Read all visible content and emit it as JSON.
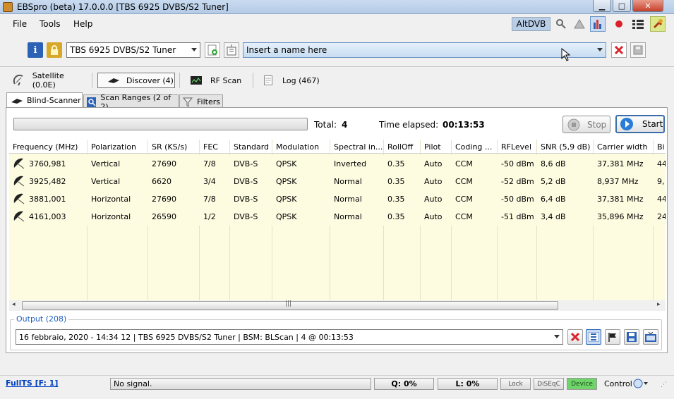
{
  "window": {
    "title": "EBSpro (beta) 17.0.0.0 [TBS 6925 DVBS/S2 Tuner]"
  },
  "menu": [
    "File",
    "Tools",
    "Help"
  ],
  "toolbar": {
    "altdvb_label": "AltDVB",
    "tuner_select": "TBS 6925 DVBS/S2 Tuner",
    "name_placeholder": "Insert a name here"
  },
  "main_tabs": [
    {
      "label": "Satellite (0.0E)",
      "icon": "satellite-dish-icon"
    },
    {
      "label": "Discover (4)",
      "icon": "discover-icon"
    },
    {
      "label": "RF Scan",
      "icon": "rf-scan-icon"
    },
    {
      "label": "Log (467)",
      "icon": "log-icon"
    }
  ],
  "sub_tabs": [
    {
      "label": "Blind-Scanner",
      "icon": "satellite-icon"
    },
    {
      "label": "Scan Ranges (2 of 2)",
      "icon": "scan-ranges-icon"
    },
    {
      "label": "Filters",
      "icon": "filter-icon"
    }
  ],
  "scan": {
    "total_label": "Total:",
    "total_value": "4",
    "elapsed_label": "Time elapsed:",
    "elapsed_value": "00:13:53",
    "stop_label": "Stop",
    "start_label": "Start"
  },
  "table": {
    "columns": [
      "Frequency (MHz)",
      "Polarization",
      "SR (KS/s)",
      "FEC",
      "Standard",
      "Modulation",
      "Spectral in...",
      "RollOff",
      "Pilot",
      "Coding ...",
      "RFLevel",
      "SNR (5,9 dB)",
      "Carrier width",
      "Bi"
    ],
    "rows": [
      [
        "3760,981",
        "Vertical",
        "27690",
        "7/8",
        "DVB-S",
        "QPSK",
        "Inverted",
        "0.35",
        "Auto",
        "CCM",
        "-50 dBm",
        "8,6 dB",
        "37,381 MHz",
        "44"
      ],
      [
        "3925,482",
        "Vertical",
        "6620",
        "3/4",
        "DVB-S",
        "QPSK",
        "Normal",
        "0.35",
        "Auto",
        "CCM",
        "-52 dBm",
        "5,2 dB",
        "8,937 MHz",
        "9,"
      ],
      [
        "3881,001",
        "Horizontal",
        "27690",
        "7/8",
        "DVB-S",
        "QPSK",
        "Normal",
        "0.35",
        "Auto",
        "CCM",
        "-50 dBm",
        "6,4 dB",
        "37,381 MHz",
        "44"
      ],
      [
        "4161,003",
        "Horizontal",
        "26590",
        "1/2",
        "DVB-S",
        "QPSK",
        "Normal",
        "0.35",
        "Auto",
        "CCM",
        "-51 dBm",
        "3,4 dB",
        "35,896 MHz",
        "24"
      ]
    ]
  },
  "output": {
    "label": "Output (208)",
    "value": "16 febbraio, 2020 - 14:34 12 | TBS 6925 DVBS/S2 Tuner | BSM: BLScan | 4 @ 00:13:53"
  },
  "status": {
    "fullts": "FullTS [F: 1]",
    "signal": "No signal.",
    "q": "Q: 0%",
    "l": "L: 0%",
    "lock": "Lock",
    "diseqc": "DiSEqC",
    "device": "Device",
    "control": "Control"
  },
  "colors": {
    "grid_bg": "#fdfbe0",
    "device_green": "#6fd46a",
    "output_label": "#1f5fbf"
  }
}
